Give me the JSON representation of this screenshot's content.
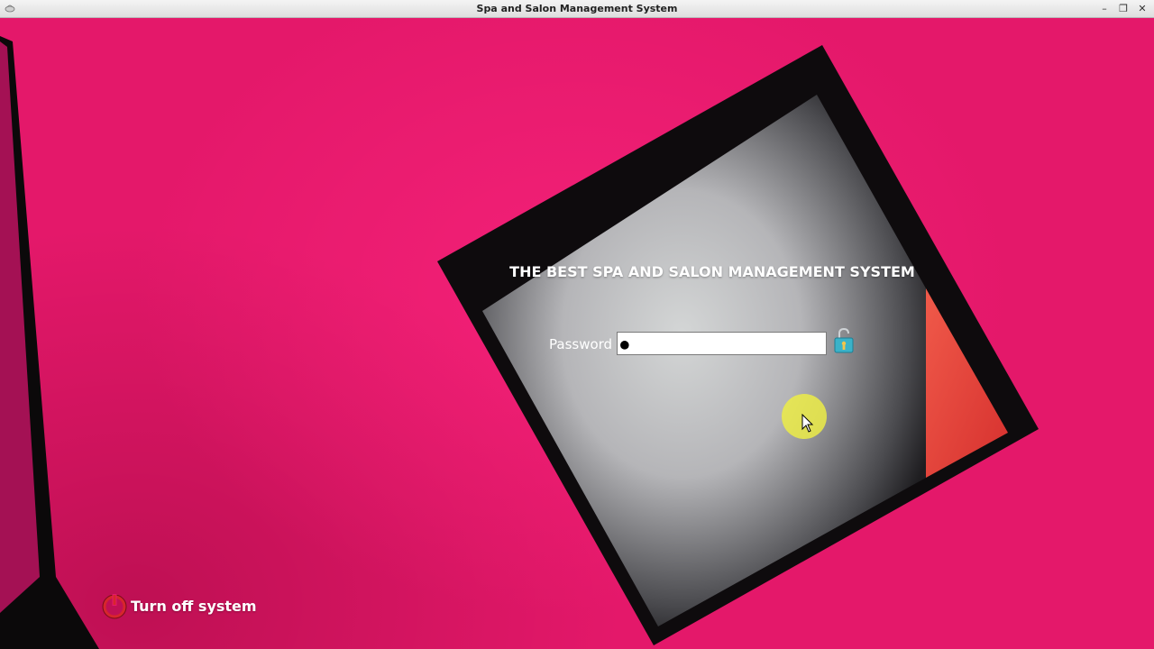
{
  "window": {
    "title": "Spa and Salon Management System",
    "minimize_glyph": "–",
    "restore_glyph": "❐",
    "close_glyph": "✕"
  },
  "login": {
    "heading": "THE BEST SPA AND SALON MANAGEMENT SYSTEM",
    "password_label": "Password",
    "password_value": "●",
    "unlock_icon": "padlock-open-icon"
  },
  "footer": {
    "turn_off_label": "Turn off system",
    "turn_off_icon": "power-icon"
  },
  "colors": {
    "background": "#e4186a",
    "panel_border": "#0e0b0d",
    "panel_inner": "#c9cacb",
    "accent_triangle": "#e8463e"
  }
}
